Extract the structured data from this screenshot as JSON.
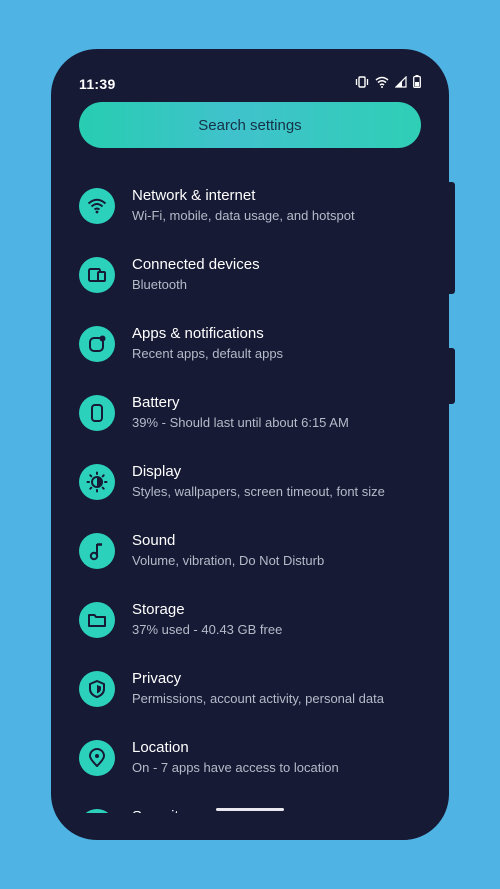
{
  "status": {
    "time": "11:39",
    "icons": [
      "vibrate-icon",
      "wifi-icon",
      "signal-icon",
      "battery-icon"
    ]
  },
  "search": {
    "placeholder": "Search settings"
  },
  "settings": [
    {
      "title": "Network & internet",
      "subtitle": "Wi-Fi, mobile, data usage, and hotspot",
      "icon": "wifi-icon"
    },
    {
      "title": "Connected devices",
      "subtitle": "Bluetooth",
      "icon": "devices-icon"
    },
    {
      "title": "Apps & notifications",
      "subtitle": "Recent apps, default apps",
      "icon": "apps-icon"
    },
    {
      "title": "Battery",
      "subtitle": "39% - Should last until about 6:15 AM",
      "icon": "battery-icon"
    },
    {
      "title": "Display",
      "subtitle": "Styles, wallpapers, screen timeout, font size",
      "icon": "brightness-icon"
    },
    {
      "title": "Sound",
      "subtitle": "Volume, vibration, Do Not Disturb",
      "icon": "music-note-icon"
    },
    {
      "title": "Storage",
      "subtitle": "37% used - 40.43 GB free",
      "icon": "folder-icon"
    },
    {
      "title": "Privacy",
      "subtitle": "Permissions, account activity, personal data",
      "icon": "shield-icon"
    },
    {
      "title": "Location",
      "subtitle": "On - 7 apps have access to location",
      "icon": "location-pin-icon"
    },
    {
      "title": "Security",
      "subtitle": "",
      "icon": "lock-icon"
    }
  ],
  "colors": {
    "background": "#4fb3e4",
    "phone": "#161a34",
    "accent": "#2cd1bb"
  }
}
